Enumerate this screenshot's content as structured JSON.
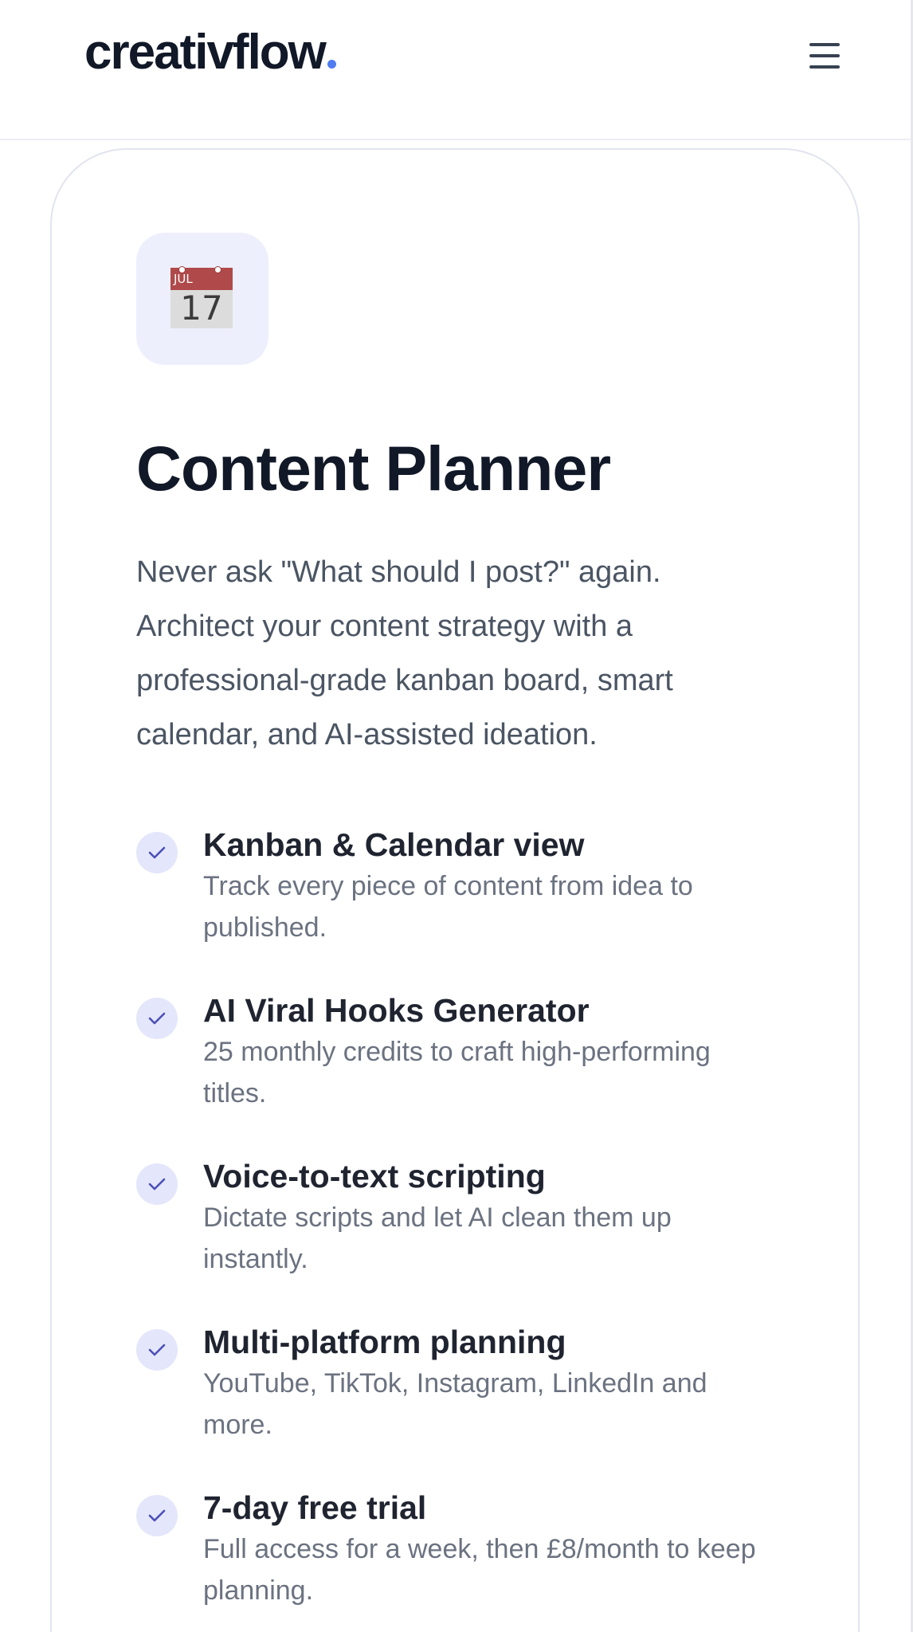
{
  "header": {
    "logo_text": "creativflow",
    "logo_dot_color": "#4f7df0",
    "menu_icon": "hamburger-menu-icon"
  },
  "card": {
    "icon": "calendar-icon",
    "calendar_month": "JUL",
    "calendar_day": "17",
    "title": "Content Planner",
    "description": "Never ask \"What should I post?\" again. Architect your content strategy with a professional-grade kanban board, smart calendar, and AI-assisted ideation.",
    "features": [
      {
        "title": "Kanban & Calendar view",
        "description": "Track every piece of content from idea to published."
      },
      {
        "title": "AI Viral Hooks Generator",
        "description": "25 monthly credits to craft high-performing titles."
      },
      {
        "title": "Voice-to-text scripting",
        "description": "Dictate scripts and let AI clean them up instantly."
      },
      {
        "title": "Multi-platform planning",
        "description": "YouTube, TikTok, Instagram, LinkedIn and more."
      },
      {
        "title": "7-day free trial",
        "description": "Full access for a week, then £8/month to keep planning."
      }
    ]
  },
  "colors": {
    "accent": "#4f7df0",
    "check_background": "#e4e6fb",
    "check_mark": "#4b4fb8",
    "icon_tile_background": "#eeeffc"
  }
}
